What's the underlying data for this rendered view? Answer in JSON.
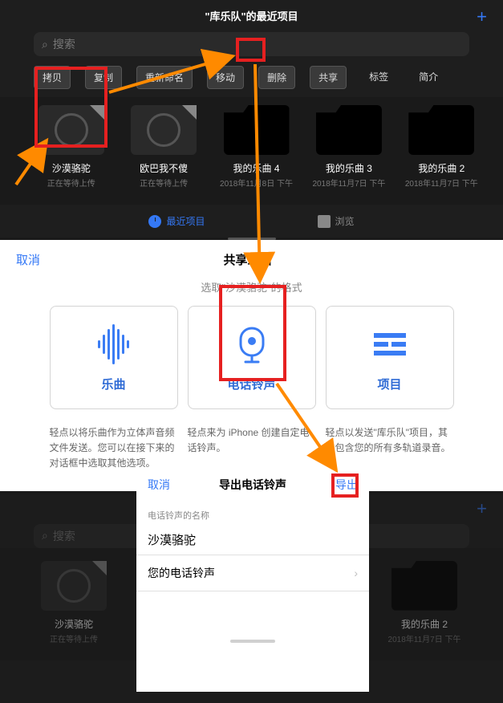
{
  "header": {
    "title": "\"库乐队\"的最近项目",
    "search_placeholder": "搜索"
  },
  "toolbar": [
    {
      "label": "拷贝",
      "chip": true
    },
    {
      "label": "复制",
      "chip": true
    },
    {
      "label": "重新命名",
      "chip": true
    },
    {
      "label": "移动",
      "chip": true
    },
    {
      "label": "删除",
      "chip": true
    },
    {
      "label": "共享",
      "chip": true
    },
    {
      "label": "标签",
      "chip": false
    },
    {
      "label": "简介",
      "chip": false
    }
  ],
  "projects": [
    {
      "name": "沙漠骆驼",
      "sub": "正在等待上传",
      "kind": "gb"
    },
    {
      "name": "欧巴我不傻",
      "sub": "正在等待上传",
      "kind": "gb"
    },
    {
      "name": "我的乐曲 4",
      "sub": "2018年11月8日 下午",
      "kind": "folder"
    },
    {
      "name": "我的乐曲 3",
      "sub": "2018年11月7日 下午",
      "kind": "folder"
    },
    {
      "name": "我的乐曲 2",
      "sub": "2018年11月7日 下午",
      "kind": "folder"
    }
  ],
  "tabs": {
    "recent": "最近项目",
    "browse": "浏览"
  },
  "share": {
    "cancel": "取消",
    "title": "共享乐曲",
    "subtitle": "选取\"沙漠骆驼\"的格式",
    "cards": [
      {
        "label": "乐曲",
        "desc": "轻点以将乐曲作为立体声音频文件发送。您可以在接下来的对话框中选取其他选项。"
      },
      {
        "label": "电话铃声",
        "desc": "轻点来为 iPhone 创建自定电话铃声。"
      },
      {
        "label": "项目",
        "desc": "轻点以发送\"库乐队\"项目，其中包含您的所有多轨道录音。"
      }
    ]
  },
  "faded_header": {
    "title": "\"库乐队\"的最近项目"
  },
  "faded_projects": [
    {
      "name": "沙漠骆驼",
      "sub": "正在等待上传",
      "kind": "gb"
    },
    {
      "name": "",
      "sub": "",
      "kind": "folder"
    },
    {
      "name": "我的乐曲 2",
      "sub": "2018年11月7日 下午",
      "kind": "folder"
    }
  ],
  "export": {
    "cancel": "取消",
    "title": "导出电话铃声",
    "confirm": "导出",
    "section": "电话铃声的名称",
    "name": "沙漠骆驼",
    "your": "您的电话铃声"
  }
}
